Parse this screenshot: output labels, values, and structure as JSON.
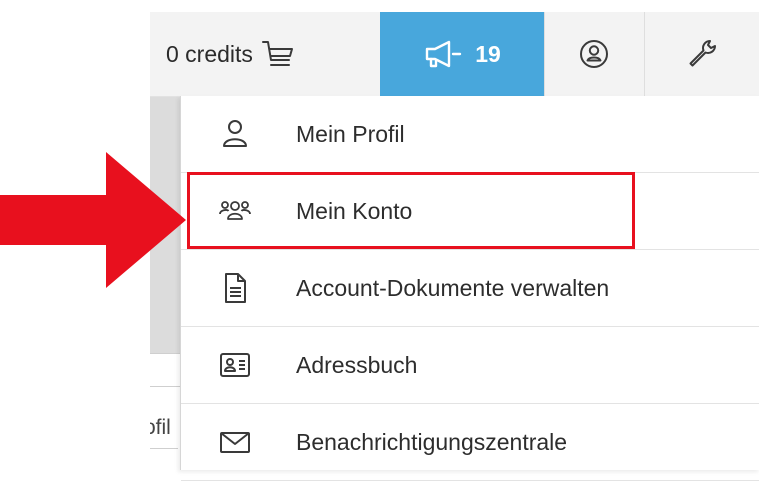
{
  "topbar": {
    "credits_label": "0 credits",
    "news_count": "19"
  },
  "menu": {
    "items": [
      {
        "label": "Mein Profil",
        "icon": "user-icon"
      },
      {
        "label": "Mein Konto",
        "icon": "users-icon"
      },
      {
        "label": "Account-Dokumente verwalten",
        "icon": "document-icon"
      },
      {
        "label": "Adressbuch",
        "icon": "address-card-icon"
      },
      {
        "label": "Benachrichtigungszentrale",
        "icon": "envelope-icon"
      }
    ]
  },
  "background": {
    "partial_text": "ofil"
  },
  "colors": {
    "news_bg": "#48a7dc",
    "highlight": "#e8101e",
    "arrow": "#e8101e"
  }
}
